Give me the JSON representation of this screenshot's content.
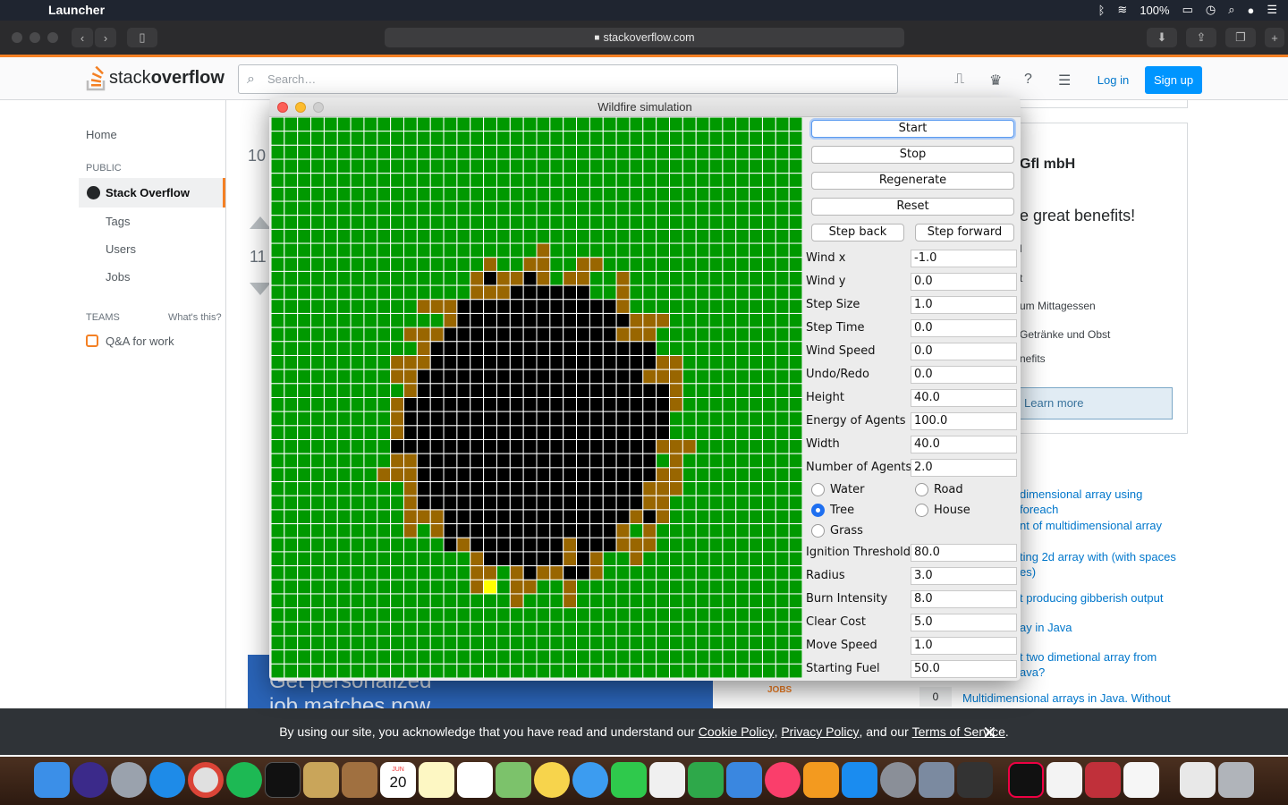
{
  "menubar": {
    "app": "Launcher",
    "battery": "100%"
  },
  "browser": {
    "url": "stackoverflow.com"
  },
  "so": {
    "logo_regular": "stack",
    "logo_bold": "overflow",
    "search_placeholder": "Search…",
    "login": "Log in",
    "signup": "Sign up",
    "nav": {
      "home": "Home",
      "public": "PUBLIC",
      "stack_overflow": "Stack Overflow",
      "tags": "Tags",
      "users": "Users",
      "jobs": "Jobs",
      "teams": "TEAMS",
      "whats_this": "What's this?",
      "qa_for_work": "Q&A for work"
    },
    "votes_top": "10",
    "votes_bottom": "11",
    "ad": {
      "company": "Gfl mbH",
      "headline": "e great benefits!",
      "lines": [
        "l",
        "t",
        "um Mittagessen",
        "Getränke und Obst",
        "nefits"
      ],
      "button": "Learn more"
    },
    "related": [
      {
        "count": "",
        "title": "dimensional array using foreach"
      },
      {
        "count": "",
        "title": "nt of multidimensional array"
      },
      {
        "count": "",
        "title": "ting 2d array with (with spaces es)"
      },
      {
        "count": "",
        "title": "t producing gibberish output"
      },
      {
        "count": "",
        "title": "ay in Java"
      },
      {
        "count": "",
        "title": "t two dimetional array from ava?"
      },
      {
        "count": "0",
        "title": "Multidimensional arrays in Java. Without"
      }
    ],
    "banner": "Get personalized job matches now",
    "jobs_logo": "JOBS"
  },
  "cookie": {
    "text_pre": "By using our site, you acknowledge that you have read and understand our ",
    "cookie_policy": "Cookie Policy",
    "sep1": ", ",
    "privacy_policy": "Privacy Policy",
    "sep2": ", and our ",
    "terms": "Terms of Service",
    "end": "."
  },
  "sim": {
    "title": "Wildfire simulation",
    "buttons": {
      "start": "Start",
      "stop": "Stop",
      "regenerate": "Regenerate",
      "reset": "Reset",
      "step_back": "Step back",
      "step_forward": "Step forward"
    },
    "fields1": [
      {
        "label": "Wind x",
        "value": "-1.0"
      },
      {
        "label": "Wind y",
        "value": "0.0"
      },
      {
        "label": "Step Size",
        "value": "1.0"
      },
      {
        "label": "Step Time",
        "value": "0.0"
      },
      {
        "label": "Wind Speed",
        "value": "0.0"
      },
      {
        "label": "Undo/Redo",
        "value": "0.0"
      },
      {
        "label": "Height",
        "value": "40.0"
      },
      {
        "label": "Energy of Agents",
        "value": "100.0"
      },
      {
        "label": "Width",
        "value": "40.0"
      },
      {
        "label": "Number of Agents",
        "value": "2.0"
      }
    ],
    "radios": {
      "water": "Water",
      "road": "Road",
      "tree": "Tree",
      "house": "House",
      "grass": "Grass",
      "selected": "Tree"
    },
    "fields2": [
      {
        "label": "Ignition Threshold",
        "value": "80.0"
      },
      {
        "label": "Radius",
        "value": "3.0"
      },
      {
        "label": "Burn Intensity",
        "value": "8.0"
      },
      {
        "label": "Clear Cost",
        "value": "5.0"
      },
      {
        "label": "Move Speed",
        "value": "1.0"
      },
      {
        "label": "Starting Fuel",
        "value": "50.0"
      }
    ],
    "grid": {
      "cols": 40,
      "rows": 40,
      "colors": {
        "tree": "#009900",
        "burnt": "#000000",
        "burning": "#996600",
        "agent": "#ffff00"
      }
    }
  },
  "dock": {
    "calendar_month": "JUN",
    "calendar_day": "20"
  }
}
